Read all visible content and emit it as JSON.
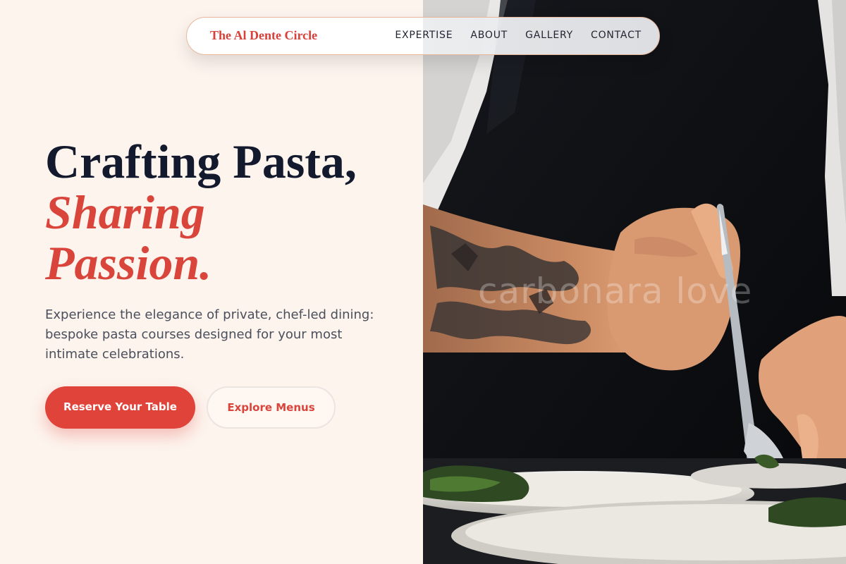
{
  "nav": {
    "brand": "The Al Dente Circle",
    "links": [
      "EXPERTISE",
      "ABOUT",
      "GALLERY",
      "CONTACT"
    ]
  },
  "hero": {
    "headline_line1": "Crafting Pasta,",
    "headline_line2": "Sharing",
    "headline_line3": "Passion.",
    "description": "Experience the elegance of private, chef-led dining: bespoke pasta courses designed for your most intimate celebrations.",
    "primary_button": "Reserve Your Table",
    "secondary_button": "Explore Menus"
  },
  "image": {
    "watermark": "carbonara love"
  },
  "colors": {
    "accent": "#e0433a",
    "background": "#fdf4ee",
    "heading": "#141a2e",
    "body_text": "#4a4f5c"
  }
}
